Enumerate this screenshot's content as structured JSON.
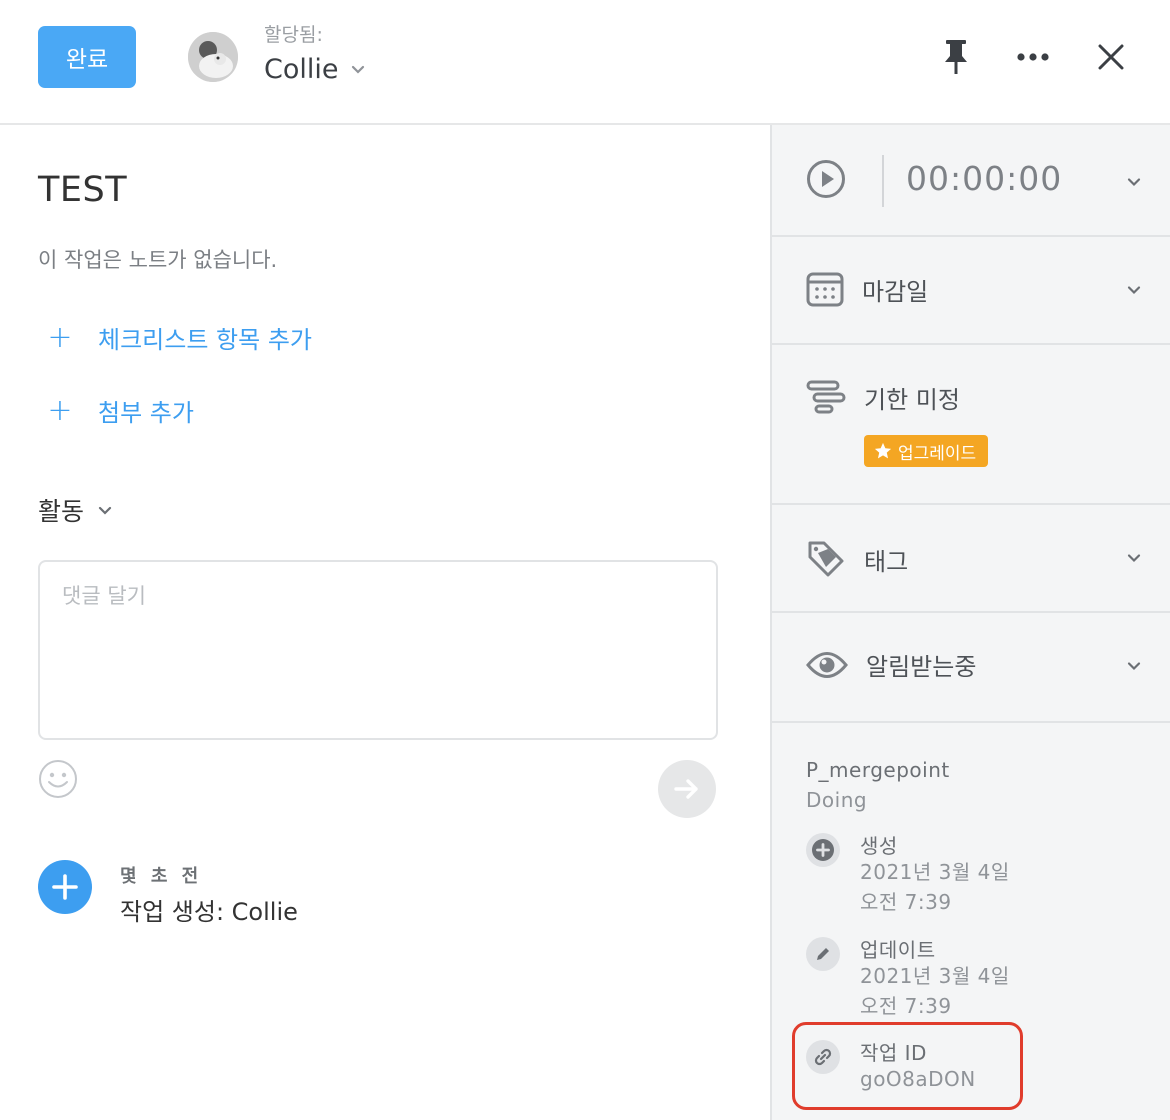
{
  "header": {
    "done_label": "완료",
    "assigned_label": "할당됨:",
    "assignee_name": "Collie",
    "icons": [
      "pin-icon",
      "more-icon",
      "close-icon"
    ]
  },
  "task": {
    "title": "TEST",
    "notes_placeholder": "이 작업은 노트가 없습니다.",
    "add_checklist": "체크리스트 항목 추가",
    "add_attachment": "첨부 추가"
  },
  "activity": {
    "heading": "활동",
    "comment_placeholder": "댓글 달기",
    "entries": [
      {
        "time": "몇 초 전",
        "text": "작업 생성: Collie"
      }
    ]
  },
  "sidebar": {
    "timer": "00:00:00",
    "due_date": "마감일",
    "duration": "기한 미정",
    "upgrade": "업그레이드",
    "tags": "태그",
    "following": "알림받는중",
    "project": "P_mergepoint",
    "section": "Doing",
    "created_label": "생성",
    "created_date": "2021년 3월 4일",
    "created_time": "오전 7:39",
    "updated_label": "업데이트",
    "updated_date": "2021년 3월 4일",
    "updated_time": "오전 7:39",
    "task_id_label": "작업 ID",
    "task_id": "goO8aDON"
  },
  "colors": {
    "accent": "#4aa8f5",
    "upgrade": "#f4a623",
    "highlight": "#e03c2c"
  }
}
